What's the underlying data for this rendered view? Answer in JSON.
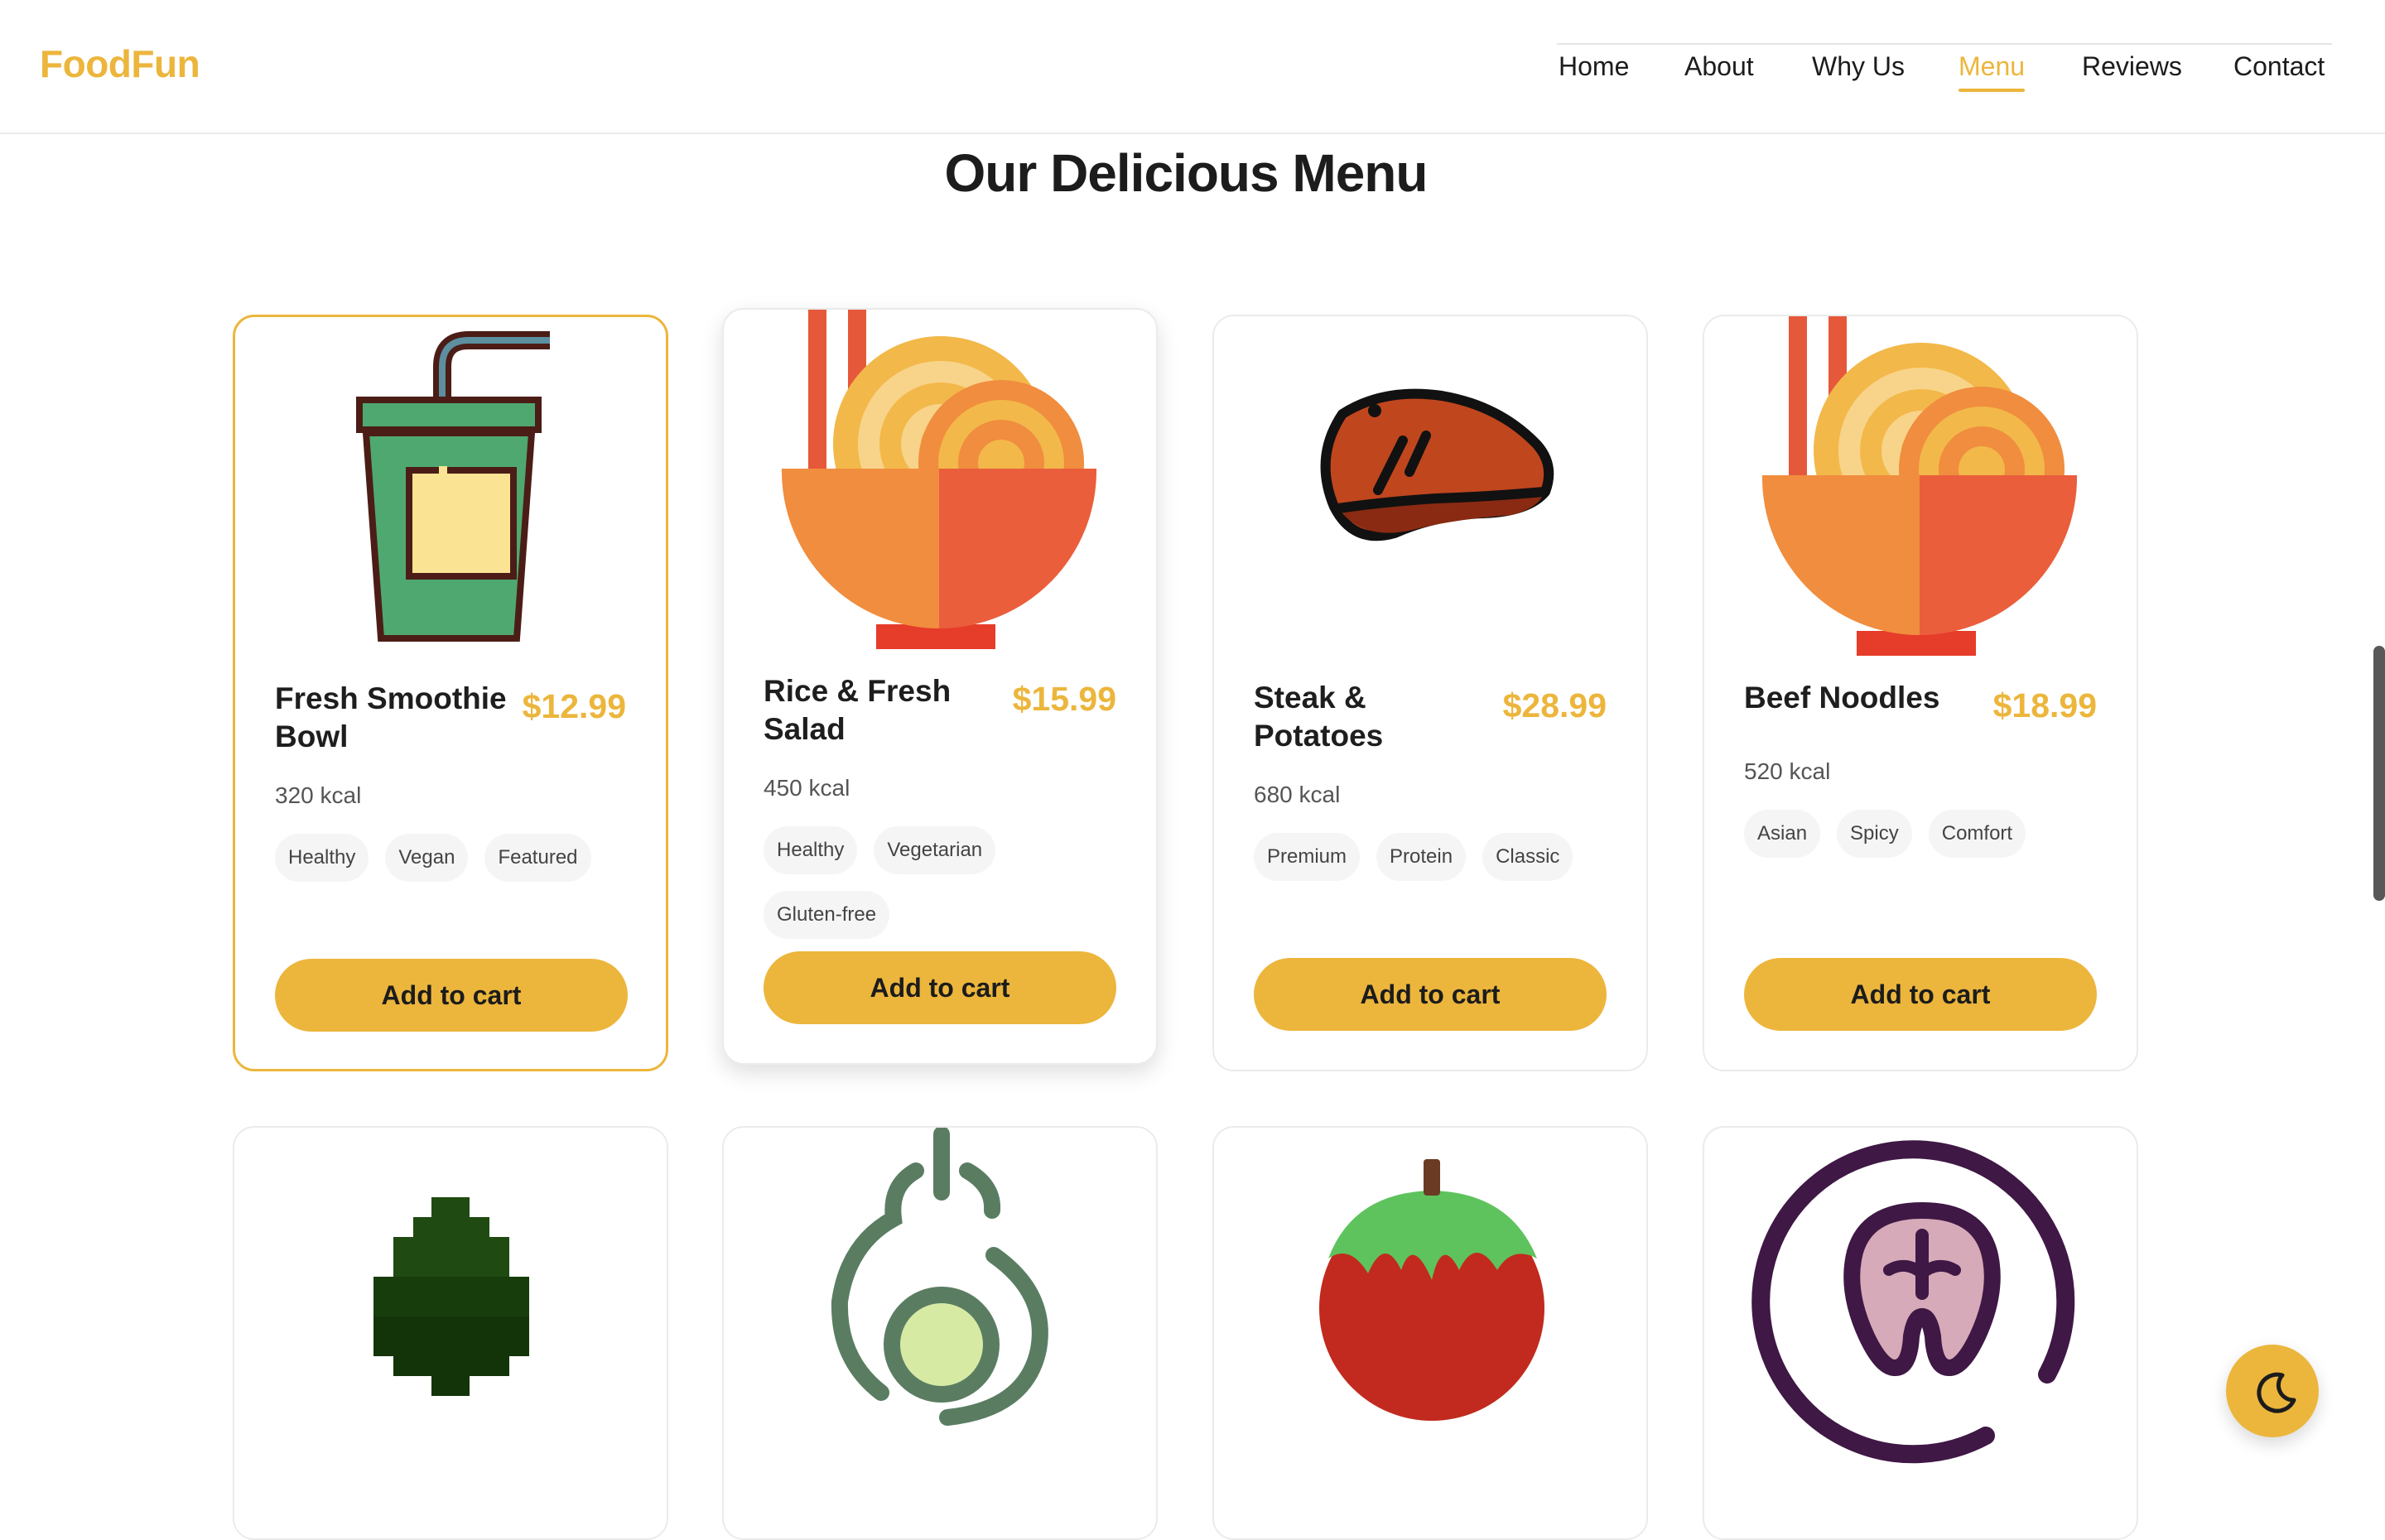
{
  "brand": {
    "logo": "FoodFun",
    "accent": "#ecb63c"
  },
  "nav": {
    "items": [
      {
        "label": "Home"
      },
      {
        "label": "About"
      },
      {
        "label": "Why Us"
      },
      {
        "label": "Menu",
        "active": true
      },
      {
        "label": "Reviews"
      },
      {
        "label": "Contact"
      }
    ]
  },
  "scroll_progress": 0.52,
  "section": {
    "title": "Our Delicious Menu"
  },
  "menu": {
    "items": [
      {
        "name": "Fresh Smoothie Bowl",
        "price": "$12.99",
        "kcal": "320 kcal",
        "tags": [
          "Healthy",
          "Vegan",
          "Featured"
        ],
        "button": "Add to cart",
        "image_icon": "smoothie-cup-icon"
      },
      {
        "name": "Rice & Fresh Salad",
        "price": "$15.99",
        "kcal": "450 kcal",
        "tags": [
          "Healthy",
          "Vegetarian",
          "Gluten-free"
        ],
        "button": "Add to cart",
        "image_icon": "noodle-bowl-icon"
      },
      {
        "name": "Steak & Potatoes",
        "price": "$28.99",
        "kcal": "680 kcal",
        "tags": [
          "Premium",
          "Protein",
          "Classic"
        ],
        "button": "Add to cart",
        "image_icon": "steak-icon"
      },
      {
        "name": "Beef Noodles",
        "price": "$18.99",
        "kcal": "520 kcal",
        "tags": [
          "Asian",
          "Spicy",
          "Comfort"
        ],
        "button": "Add to cart",
        "image_icon": "noodle-bowl-icon"
      },
      {
        "image_icon": "pixel-avocado-icon"
      },
      {
        "image_icon": "avocado-outline-icon"
      },
      {
        "image_icon": "tomato-icon"
      },
      {
        "image_icon": "salmon-steak-icon"
      }
    ]
  },
  "theme_toggle": {
    "icon": "moon-icon"
  }
}
